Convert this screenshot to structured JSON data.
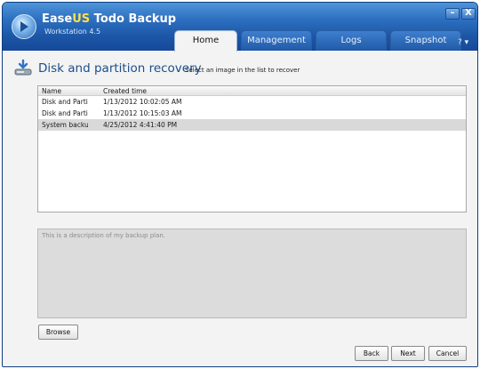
{
  "app": {
    "name_part1": "Ease",
    "name_part2": "US",
    "name_part3": "Todo Backup",
    "edition": "Workstation 4.5",
    "window_controls": {
      "minimize": "–",
      "close": "X"
    },
    "help": "? ▾"
  },
  "tabs": [
    {
      "label": "Home",
      "active": true
    },
    {
      "label": "Management",
      "active": false
    },
    {
      "label": "Logs",
      "active": false
    },
    {
      "label": "Snapshot",
      "active": false
    }
  ],
  "page": {
    "title": "Disk and partition recovery",
    "subtitle": "Select an image in the list to recover"
  },
  "image_list": {
    "columns": [
      "Name",
      "Created time"
    ],
    "rows": [
      {
        "name": "Disk and Partiti...",
        "created": "1/13/2012 10:02:05 AM",
        "selected": false
      },
      {
        "name": "Disk and Partiti...",
        "created": "1/13/2012 10:15:03 AM",
        "selected": false
      },
      {
        "name": "System backup...",
        "created": "4/25/2012 4:41:40 PM",
        "selected": true
      }
    ]
  },
  "description": {
    "text": "This is a description of my backup plan."
  },
  "buttons": {
    "browse": "Browse",
    "back": "Back",
    "next": "Next",
    "cancel": "Cancel"
  }
}
